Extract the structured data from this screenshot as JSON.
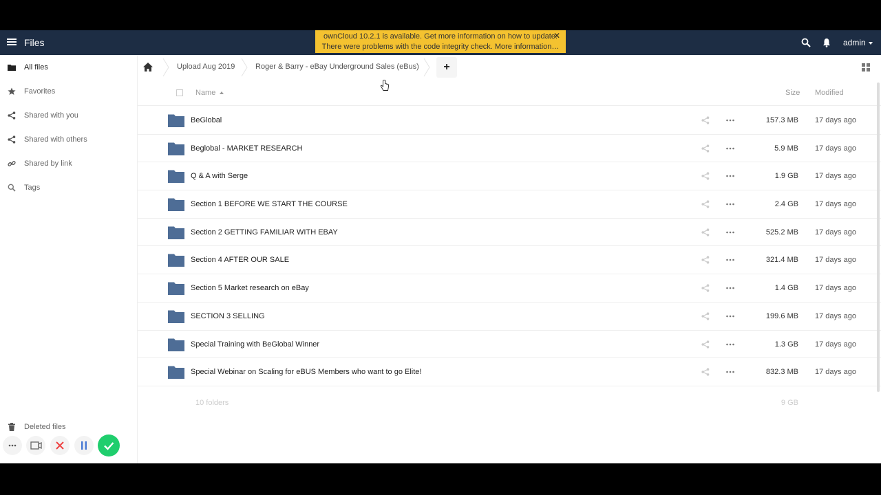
{
  "header": {
    "app_title": "Files",
    "notice_line1": "ownCloud 10.2.1 is available. Get more information on how to update.",
    "notice_line2": "There were problems with the code integrity check. More information…",
    "notice_close": "✕",
    "user": "admin"
  },
  "sidebar": {
    "items": [
      {
        "label": "All files",
        "icon": "folder-icon"
      },
      {
        "label": "Favorites",
        "icon": "star-icon"
      },
      {
        "label": "Shared with you",
        "icon": "share-icon"
      },
      {
        "label": "Shared with others",
        "icon": "share-icon"
      },
      {
        "label": "Shared by link",
        "icon": "link-icon"
      },
      {
        "label": "Tags",
        "icon": "search-icon"
      }
    ],
    "deleted_files": "Deleted files"
  },
  "breadcrumb": {
    "items": [
      "Upload Aug 2019",
      "Roger & Barry - eBay Underground Sales (eBus)"
    ],
    "add_label": "+"
  },
  "columns": {
    "name": "Name",
    "size": "Size",
    "modified": "Modified"
  },
  "files": [
    {
      "name": "BeGlobal",
      "size": "157.3 MB",
      "modified": "17 days ago"
    },
    {
      "name": "Beglobal - MARKET RESEARCH",
      "size": "5.9 MB",
      "modified": "17 days ago"
    },
    {
      "name": "Q & A with Serge",
      "size": "1.9 GB",
      "modified": "17 days ago"
    },
    {
      "name": "Section 1 BEFORE WE START THE COURSE",
      "size": "2.4 GB",
      "modified": "17 days ago"
    },
    {
      "name": "Section 2 GETTING FAMILIAR WITH EBAY",
      "size": "525.2 MB",
      "modified": "17 days ago"
    },
    {
      "name": "Section 4 AFTER OUR SALE",
      "size": "321.4 MB",
      "modified": "17 days ago"
    },
    {
      "name": "Section 5 Market research on eBay",
      "size": "1.4 GB",
      "modified": "17 days ago"
    },
    {
      "name": "SECTION 3 SELLING",
      "size": "199.6 MB",
      "modified": "17 days ago"
    },
    {
      "name": "Special Training with BeGlobal Winner",
      "size": "1.3 GB",
      "modified": "17 days ago"
    },
    {
      "name": "Special Webinar on Scaling for eBUS Members who want to go Elite!",
      "size": "832.3 MB",
      "modified": "17 days ago"
    }
  ],
  "summary": {
    "count": "10 folders",
    "total": "9 GB"
  },
  "colors": {
    "header_bg": "#1d2d44",
    "notice_bg": "#f4c230",
    "folder": "#4e6d96",
    "accept": "#1fce6d"
  }
}
